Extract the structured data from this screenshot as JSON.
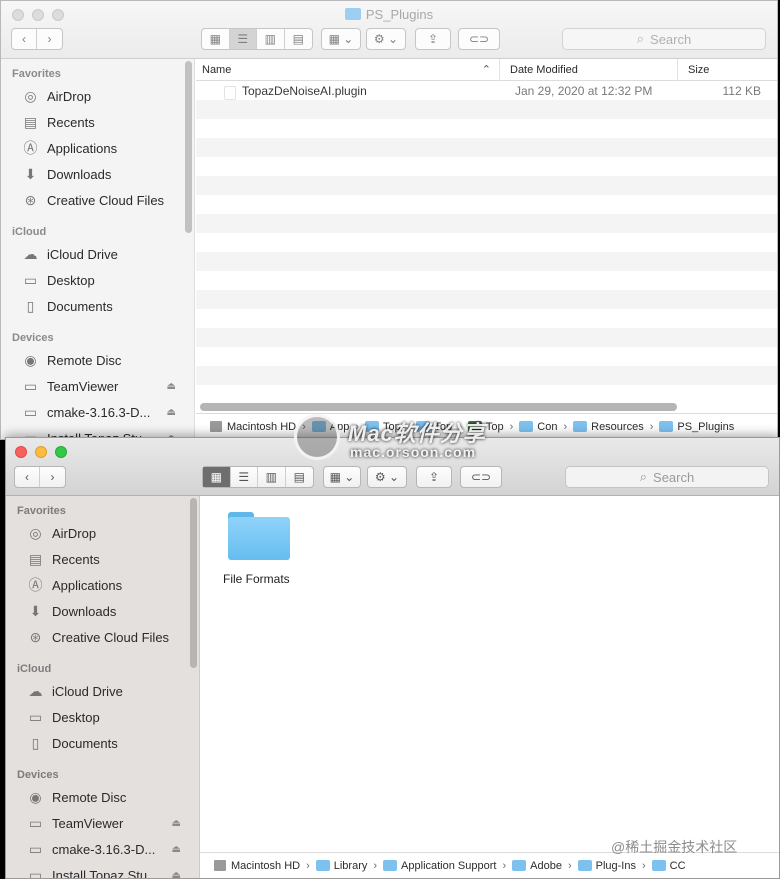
{
  "window1": {
    "title": "PS_Plugins",
    "search_placeholder": "Search",
    "columns": {
      "name": "Name",
      "date": "Date Modified",
      "size": "Size"
    },
    "files": [
      {
        "name": "TopazDeNoiseAI.plugin",
        "date": "Jan 29, 2020 at 12:32 PM",
        "size": "112 KB"
      }
    ],
    "path": [
      "Macintosh HD",
      "App",
      "Top",
      "Top",
      "Top",
      "Con",
      "Resources",
      "PS_Plugins"
    ]
  },
  "window2": {
    "search_placeholder": "Search",
    "folder": "File Formats",
    "path": [
      "Macintosh HD",
      "Library",
      "Application Support",
      "Adobe",
      "Plug-Ins",
      "CC"
    ]
  },
  "sidebar": {
    "favorites_label": "Favorites",
    "favorites": [
      "AirDrop",
      "Recents",
      "Applications",
      "Downloads",
      "Creative Cloud Files"
    ],
    "icloud_label": "iCloud",
    "icloud": [
      "iCloud Drive",
      "Desktop",
      "Documents"
    ],
    "devices_label": "Devices",
    "devices": [
      "Remote Disc",
      "TeamViewer",
      "cmake-3.16.3-D...",
      "Install Topaz Stu..."
    ]
  },
  "watermark": {
    "top": "Mac软件分享",
    "url": "mac.orsoon.com",
    "bottom": "@稀土掘金技术社区"
  },
  "icons": {
    "view_icons": "grid-icon",
    "view_list": "list-icon",
    "view_columns": "columns-icon",
    "view_gallery": "gallery-icon",
    "group": "group-icon",
    "action": "gear-icon",
    "share": "share-icon",
    "tag": "tag-icon"
  }
}
